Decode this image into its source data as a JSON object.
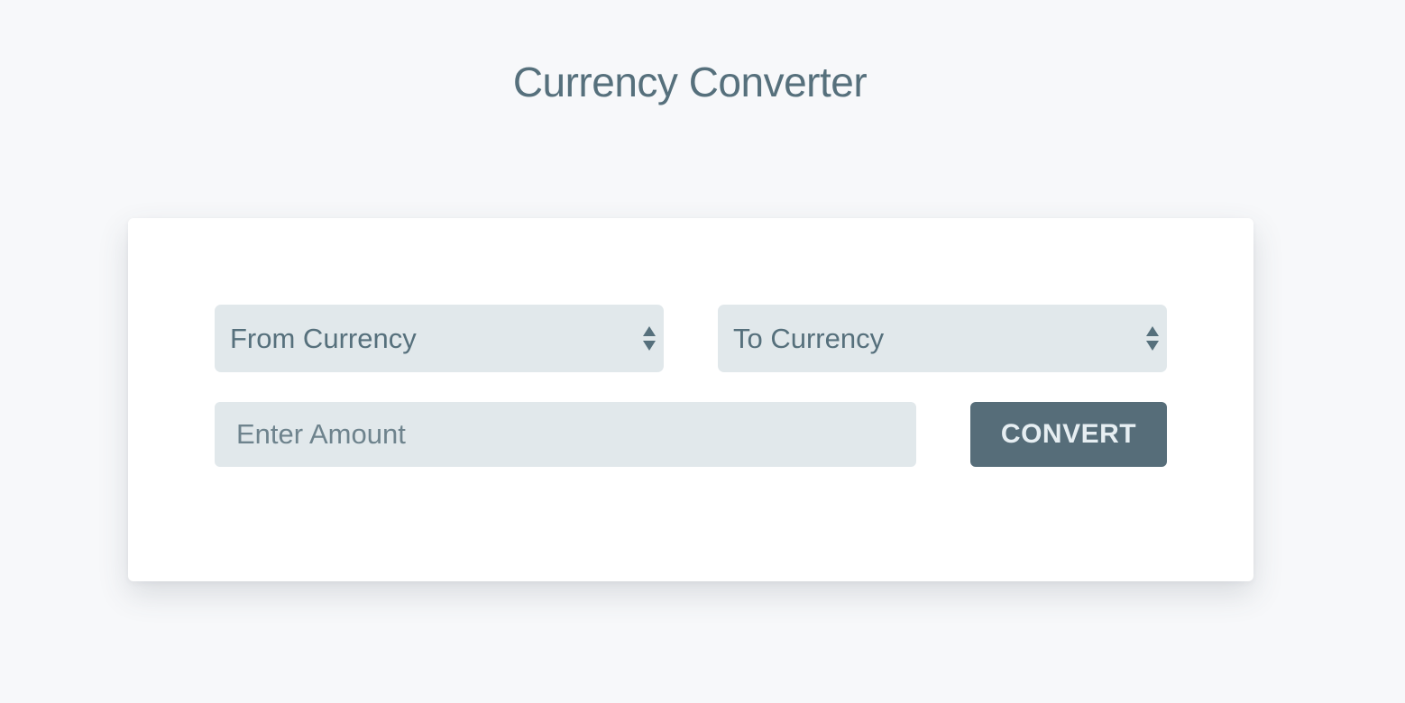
{
  "page": {
    "title": "Currency Converter"
  },
  "form": {
    "from_select": {
      "selected_label": "From Currency"
    },
    "to_select": {
      "selected_label": "To Currency"
    },
    "amount_input": {
      "value": "",
      "placeholder": "Enter Amount"
    },
    "convert_label": "CONVERT"
  },
  "icons": {
    "select_arrows": "up-down-arrows-icon"
  },
  "colors": {
    "background": "#f7f8fa",
    "card": "#ffffff",
    "field": "#e1e8eb",
    "text": "#56707c",
    "button": "#566d79",
    "button_text": "#e6eef2"
  }
}
